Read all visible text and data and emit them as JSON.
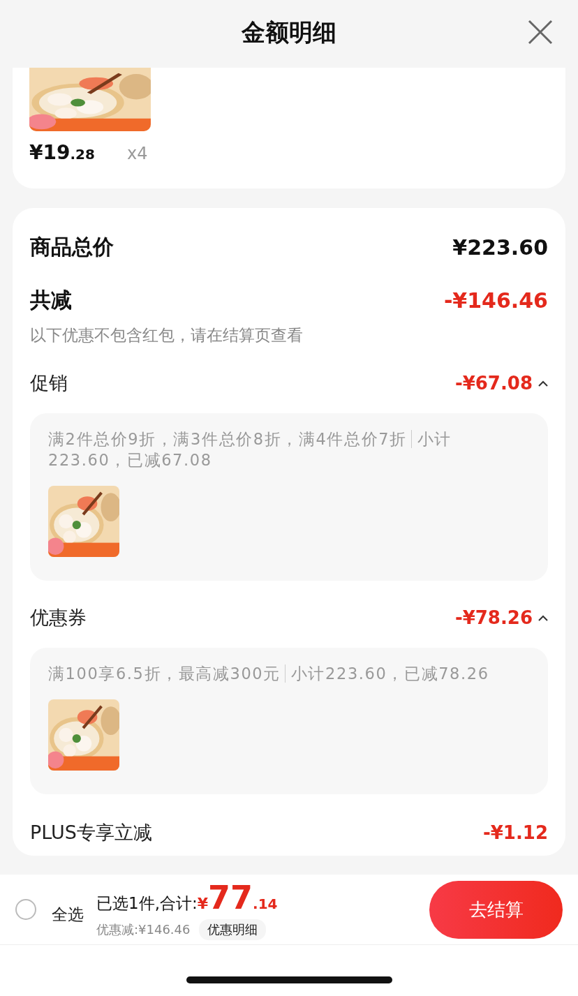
{
  "header": {
    "title": "金额明细"
  },
  "product": {
    "kind": "picture",
    "price_main": "¥19",
    "price_decimal": ".28",
    "quantity": "x4"
  },
  "summary": {
    "total_label": "商品总价",
    "total": "¥223.60",
    "reduce_label": "共减",
    "reduce": "-¥146.46",
    "note": "以下优惠不包含红包，请在结算页查看"
  },
  "discounts": [
    {
      "kind": "group",
      "label": "促销",
      "amount": "-¥67.08",
      "expanded": true,
      "rule": "满2件总价9折，满3件总价8折，满4件总价7折",
      "subtotal": "小计223.60，已减67.08"
    },
    {
      "kind": "group",
      "label": "优惠券",
      "amount": "-¥78.26",
      "expanded": true,
      "rule": "满100享6.5折，最高减300元",
      "subtotal": "小计223.60，已减78.26"
    },
    {
      "kind": "plain",
      "label": "PLUS专享立减",
      "amount": "-¥1.12"
    }
  ],
  "bottom_bar": {
    "select_all": {
      "label": "全选",
      "checked": false
    },
    "selected_text": "已选1件,合计:",
    "currency": "¥",
    "total_main": "77",
    "total_decimal": ".14",
    "saved": "优惠减:¥146.46",
    "detail_link": "优惠明细",
    "checkout": "去结算"
  }
}
